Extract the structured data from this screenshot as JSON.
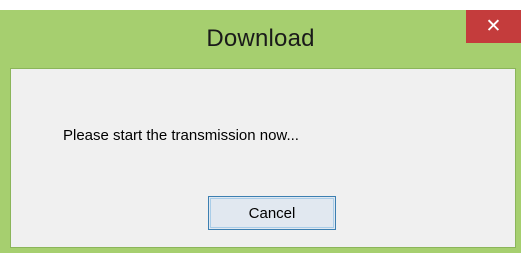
{
  "window": {
    "title": "Download",
    "close_icon": "close-icon",
    "close_glyph": "✕"
  },
  "dialog": {
    "message": "Please start the transmission now...",
    "cancel_label": "Cancel"
  },
  "colors": {
    "frame": "#a6cf6f",
    "close_button": "#c43c3c",
    "client_background": "#f0f0f0",
    "button_border": "#3c7fb1"
  }
}
